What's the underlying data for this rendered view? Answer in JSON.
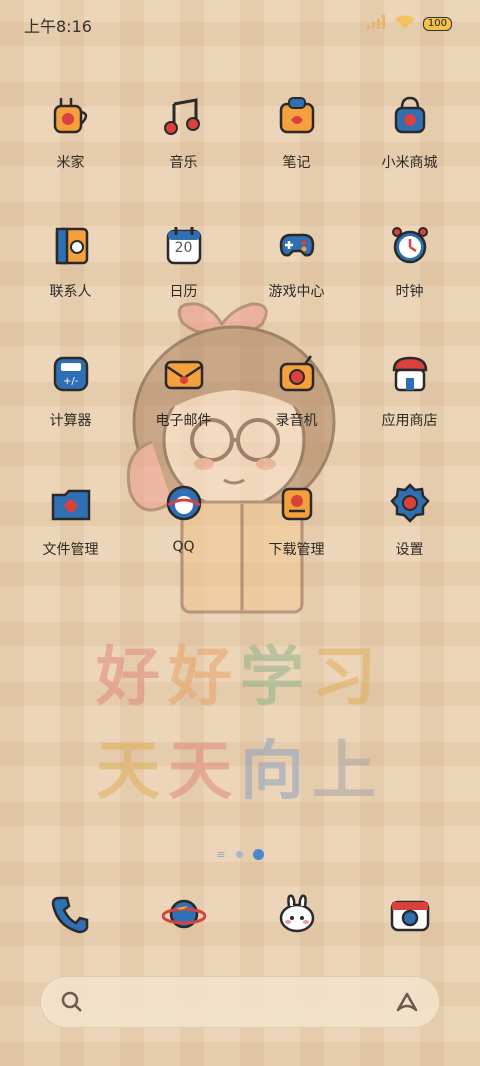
{
  "status_bar": {
    "time": "上午8:16",
    "battery": "100",
    "icons": [
      "signal-icon",
      "wifi-icon",
      "battery-icon"
    ]
  },
  "apps": [
    {
      "label": "米家",
      "icon": "mijia-icon"
    },
    {
      "label": "音乐",
      "icon": "music-icon"
    },
    {
      "label": "笔记",
      "icon": "notes-icon"
    },
    {
      "label": "小米商城",
      "icon": "mi-store-icon"
    },
    {
      "label": "联系人",
      "icon": "contacts-icon"
    },
    {
      "label": "日历",
      "icon": "calendar-icon",
      "date": "20"
    },
    {
      "label": "游戏中心",
      "icon": "game-center-icon"
    },
    {
      "label": "时钟",
      "icon": "clock-icon"
    },
    {
      "label": "计算器",
      "icon": "calculator-icon"
    },
    {
      "label": "电子邮件",
      "icon": "email-icon"
    },
    {
      "label": "录音机",
      "icon": "recorder-icon"
    },
    {
      "label": "应用商店",
      "icon": "app-store-icon"
    },
    {
      "label": "文件管理",
      "icon": "file-manager-icon"
    },
    {
      "label": "QQ",
      "icon": "qq-icon"
    },
    {
      "label": "下载管理",
      "icon": "download-manager-icon"
    },
    {
      "label": "设置",
      "icon": "settings-icon"
    }
  ],
  "wallpaper": {
    "line1": [
      "好",
      "好",
      "学",
      "习"
    ],
    "line2": [
      "天",
      "天",
      "向",
      "上"
    ],
    "line1_colors": [
      "#e08a80",
      "#e8a36a",
      "#8fb58a",
      "#e1b05a"
    ],
    "line2_colors": [
      "#e1b05a",
      "#e08a80",
      "#8fa1c0",
      "#a5a5a5"
    ]
  },
  "page_indicator": {
    "pages": 2,
    "active": 2
  },
  "dock": [
    {
      "icon": "phone-icon"
    },
    {
      "icon": "browser-icon"
    },
    {
      "icon": "messages-icon"
    },
    {
      "icon": "camera-icon"
    }
  ],
  "colors": {
    "background": "#ecd5b8",
    "icon_blue": "#2f6fb4",
    "icon_red": "#d9423c",
    "icon_orange": "#f4a13d"
  }
}
